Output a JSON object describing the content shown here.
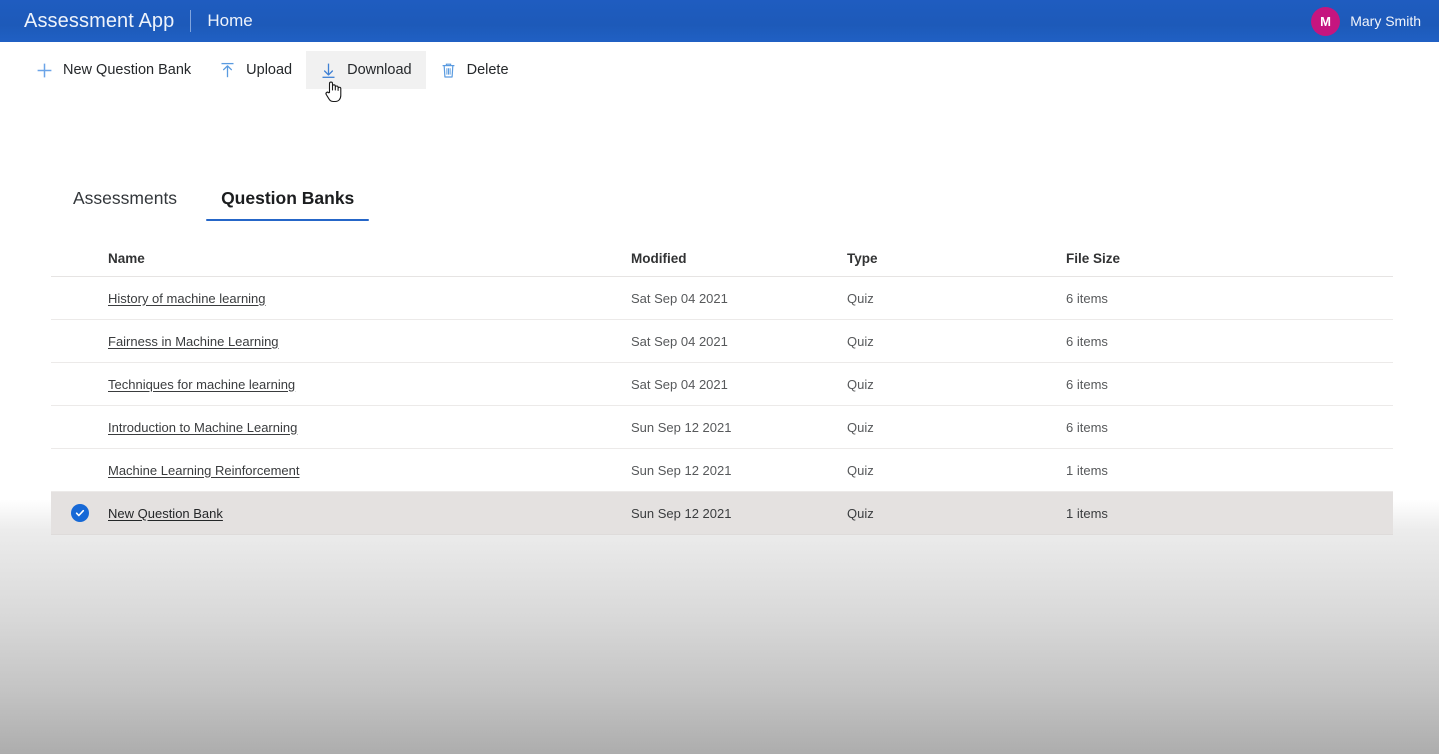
{
  "header": {
    "app_title": "Assessment App",
    "section": "Home",
    "user": {
      "initial": "M",
      "name": "Mary Smith",
      "avatar_color": "#c5157f"
    },
    "bar_color": "#1f5cc0"
  },
  "toolbar": {
    "items": [
      {
        "label": "New Question Bank",
        "icon": "plus-icon",
        "hover": false
      },
      {
        "label": "Upload",
        "icon": "upload-icon",
        "hover": false
      },
      {
        "label": "Download",
        "icon": "download-icon",
        "hover": true
      },
      {
        "label": "Delete",
        "icon": "trash-icon",
        "hover": false
      }
    ]
  },
  "tabs": [
    {
      "label": "Assessments",
      "active": false
    },
    {
      "label": "Question Banks",
      "active": true
    }
  ],
  "table": {
    "columns": [
      "Name",
      "Modified",
      "Type",
      "File Size"
    ],
    "rows": [
      {
        "name": "History of machine learning",
        "modified": "Sat Sep 04 2021",
        "type": "Quiz",
        "size": "6 items",
        "selected": false
      },
      {
        "name": "Fairness in Machine Learning",
        "modified": "Sat Sep 04 2021",
        "type": "Quiz",
        "size": "6 items",
        "selected": false
      },
      {
        "name": "Techniques for machine learning",
        "modified": "Sat Sep 04 2021",
        "type": "Quiz",
        "size": "6 items",
        "selected": false
      },
      {
        "name": "Introduction to Machine Learning",
        "modified": "Sun Sep 12 2021",
        "type": "Quiz",
        "size": "6 items",
        "selected": false
      },
      {
        "name": "Machine Learning Reinforcement",
        "modified": "Sun Sep 12 2021",
        "type": "Quiz",
        "size": "1 items",
        "selected": false
      },
      {
        "name": "New Question Bank",
        "modified": "Sun Sep 12 2021",
        "type": "Quiz",
        "size": "1 items",
        "selected": true
      }
    ]
  },
  "colors": {
    "accent_blue": "#2566c8",
    "icon_blue": "#4a90e2",
    "selected_row": "#e4e1e0",
    "check_blue": "#1668d6"
  }
}
